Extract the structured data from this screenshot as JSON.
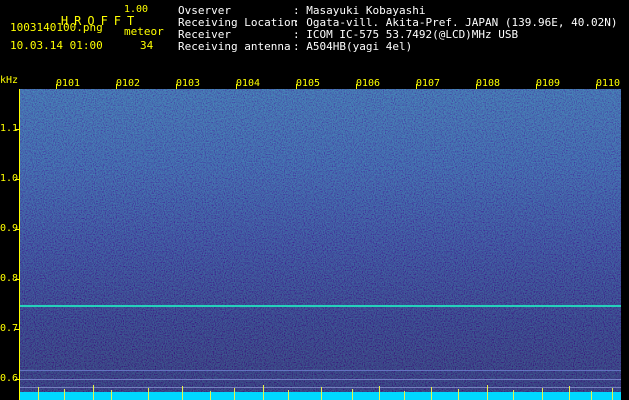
{
  "app": {
    "name": "HROFFT",
    "version": "1.00"
  },
  "file": {
    "filename": "1003140100.png",
    "datetime": "10.03.14 01:00"
  },
  "meteor": {
    "label": "meteor",
    "count": "34"
  },
  "info": [
    {
      "key": "Ovserver",
      "value": ": Masayuki Kobayashi"
    },
    {
      "key": "Receiving Location",
      "value": ": Ogata-vill. Akita-Pref. JAPAN (139.96E, 40.02N)"
    },
    {
      "key": "Receiver",
      "value": ": ICOM IC-575 53.7492(@LCD)MHz USB"
    },
    {
      "key": "Receiving antenna",
      "value": ": A504HB(yagi 4el)"
    }
  ],
  "axes": {
    "y_unit": "kHz",
    "y_ticks": [
      "1.1",
      "1.0",
      "0.9",
      "0.8",
      "0.7",
      "0.6"
    ],
    "x_ticks": [
      "0101",
      "0102",
      "0103",
      "0104",
      "0105",
      "0106",
      "0107",
      "0108",
      "0109",
      "0110"
    ]
  },
  "colors": {
    "label": "#ffff00",
    "text": "#ffffff",
    "background": "#000000",
    "trace": "#22e0c0",
    "meteor_band": "#00e0ff"
  }
}
